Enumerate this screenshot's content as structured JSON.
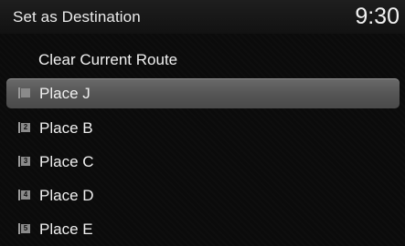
{
  "header": {
    "title": "Set as Destination",
    "clock": "9:30"
  },
  "actions": {
    "clear_route": "Clear Current Route"
  },
  "places": [
    {
      "badge": "",
      "label": "Place J",
      "selected": true
    },
    {
      "badge": "2",
      "label": "Place B"
    },
    {
      "badge": "3",
      "label": "Place C"
    },
    {
      "badge": "4",
      "label": "Place D"
    },
    {
      "badge": "5",
      "label": "Place E"
    }
  ]
}
